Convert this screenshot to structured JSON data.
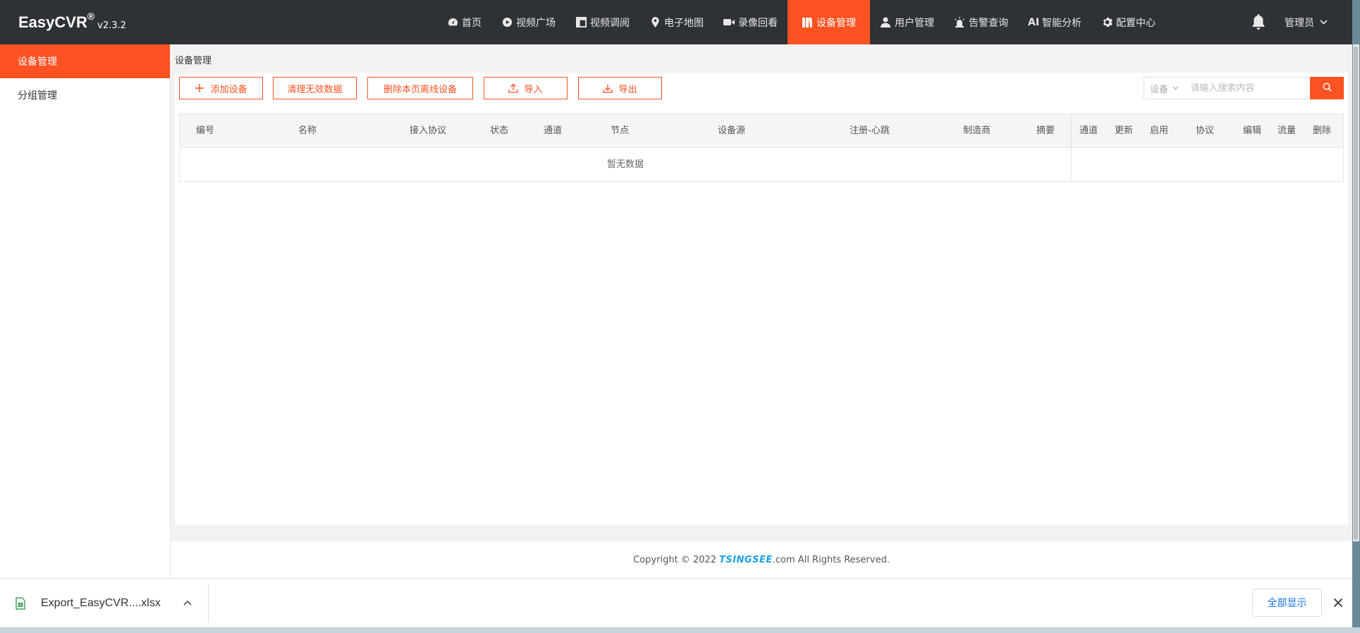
{
  "app": {
    "brand": "EasyCVR",
    "brand_mark": "®",
    "version": "v2.3.2"
  },
  "nav": {
    "items": [
      {
        "label": "首页",
        "icon": "dashboard-icon"
      },
      {
        "label": "视频广场",
        "icon": "play-circle-icon"
      },
      {
        "label": "视频调阅",
        "icon": "layout-grid-icon"
      },
      {
        "label": "电子地图",
        "icon": "map-pin-icon"
      },
      {
        "label": "录像回看",
        "icon": "video-camera-icon"
      },
      {
        "label": "设备管理",
        "icon": "device-columns-icon",
        "active": true
      },
      {
        "label": "用户管理",
        "icon": "user-icon"
      },
      {
        "label": "告警查询",
        "icon": "alarm-icon"
      },
      {
        "label": "智能分析",
        "icon": "ai-icon",
        "prefix": "AI"
      },
      {
        "label": "配置中心",
        "icon": "gear-icon"
      }
    ],
    "user": "管理员",
    "accent": "#fd5222"
  },
  "sidebar": {
    "items": [
      {
        "label": "设备管理",
        "active": true
      },
      {
        "label": "分组管理"
      }
    ]
  },
  "main": {
    "breadcrumb": "设备管理",
    "toolbar": {
      "add": "添加设备",
      "clean": "清理无效数据",
      "delete_offline": "删除本页离线设备",
      "import": "导入",
      "export": "导出"
    },
    "search": {
      "scope": "设备",
      "placeholder": "请输入搜索内容"
    },
    "table": {
      "columns": [
        "编号",
        "名称",
        "接入协议",
        "状态",
        "通道",
        "节点",
        "设备源",
        "注册-心跳",
        "制造商",
        "摘要"
      ],
      "fixed_columns": [
        "通道",
        "更新",
        "启用",
        "协议",
        "编辑",
        "流量",
        "删除"
      ],
      "empty_text": "暂无数据",
      "rows": []
    }
  },
  "footer": {
    "prefix": "Copyright © 2022",
    "logo": "TSINGSEE",
    "suffix": ".com All Rights Reserved."
  },
  "download_bar": {
    "file_name": "Export_EasyCVR....xlsx",
    "show_all": "全部显示"
  }
}
